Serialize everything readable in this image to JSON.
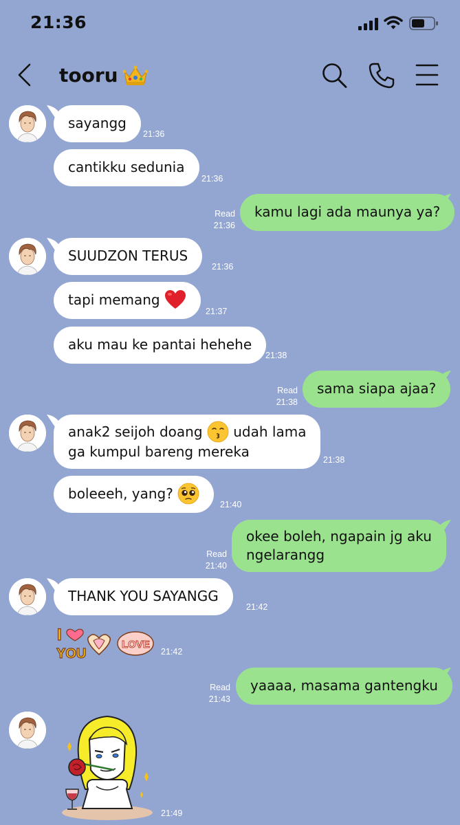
{
  "status_bar": {
    "time": "21:36"
  },
  "header": {
    "title": "tooru",
    "title_icon": "crown-icon"
  },
  "messages": [
    {
      "dir": "in",
      "text": "sayangg",
      "time": "21:36"
    },
    {
      "dir": "in",
      "text": "cantikku sedunia",
      "time": "21:36"
    },
    {
      "dir": "out",
      "text": "kamu lagi ada maunya ya?",
      "read": "Read",
      "time": "21:36"
    },
    {
      "dir": "in",
      "text": "SUUDZON TERUS",
      "time": "21:36"
    },
    {
      "dir": "in",
      "text": "tapi memang",
      "emoji": "red-heart-emoji",
      "time": "21:37"
    },
    {
      "dir": "in",
      "text": "aku mau ke pantai hehehe",
      "time": "21:38"
    },
    {
      "dir": "out",
      "text": "sama siapa ajaa?",
      "read": "Read",
      "time": "21:38"
    },
    {
      "dir": "in",
      "text_line1_a": "anak2 seijoh doang",
      "emoji": "kissing-emoji",
      "text_line1_b": "udah lama",
      "text_line2": "ga kumpul bareng mereka",
      "time": "21:38"
    },
    {
      "dir": "in",
      "text": "boleeeh, yang?",
      "emoji": "pleading-face-emoji",
      "time": "21:40"
    },
    {
      "dir": "out",
      "text_line1": "okee boleh, ngapain jg aku",
      "text_line2": "ngelarangg",
      "read": "Read",
      "time": "21:40"
    },
    {
      "dir": "in",
      "text": "THANK YOU SAYANGG",
      "time": "21:42"
    },
    {
      "dir": "in",
      "type": "sticker",
      "sticker": "i-love-you-sticker",
      "sticker_text": [
        "I",
        "YOU",
        "LOVE"
      ],
      "time": "21:42"
    },
    {
      "dir": "out",
      "text": "yaaaa, masama gantengku",
      "read": "Read",
      "time": "21:43"
    },
    {
      "dir": "in",
      "type": "sticker",
      "sticker": "blonde-man-rose-wine-sticker",
      "time": "21:49"
    }
  ]
}
